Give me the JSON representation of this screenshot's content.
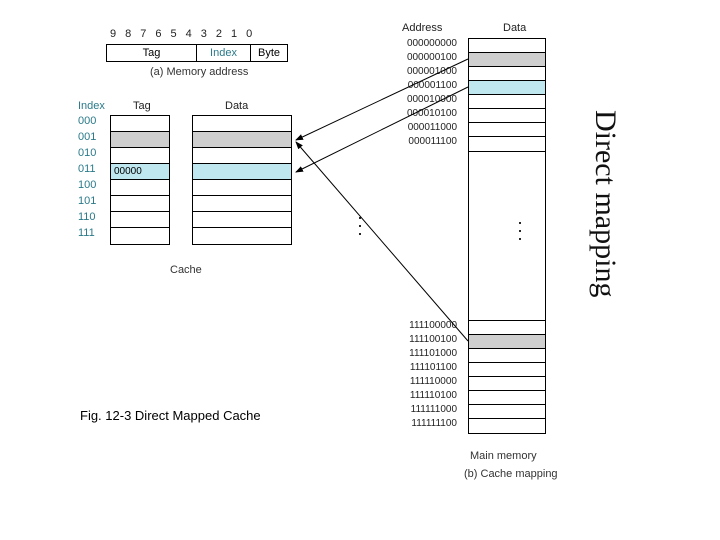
{
  "title_vertical": "Direct mapping",
  "fig_caption": "Fig. 12-3 Direct Mapped Cache",
  "addr_bits": [
    "9",
    "8",
    "7",
    "6",
    "5",
    "4",
    "3",
    "2",
    "1",
    "0"
  ],
  "addr_segments": {
    "tag": "Tag",
    "index": "Index",
    "byte": "Byte"
  },
  "caption_a": "(a) Memory address",
  "cache": {
    "hdr_index": "Index",
    "hdr_tag": "Tag",
    "hdr_data": "Data",
    "label": "Cache",
    "indices": [
      "000",
      "001",
      "010",
      "011",
      "100",
      "101",
      "110",
      "111"
    ],
    "tags": [
      "",
      "",
      "",
      "00000",
      "",
      "",
      "",
      ""
    ]
  },
  "mem": {
    "hdr_address": "Address",
    "hdr_data": "Data",
    "top_addrs": [
      "000000000",
      "000000100",
      "000001000",
      "000001100",
      "000010000",
      "000010100",
      "000011000",
      "000011100"
    ],
    "bot_addrs": [
      "111100000",
      "111100100",
      "111101000",
      "111101100",
      "111110000",
      "111110100",
      "111111000",
      "111111100"
    ],
    "label_main": "Main memory",
    "caption_b": "(b) Cache mapping"
  }
}
